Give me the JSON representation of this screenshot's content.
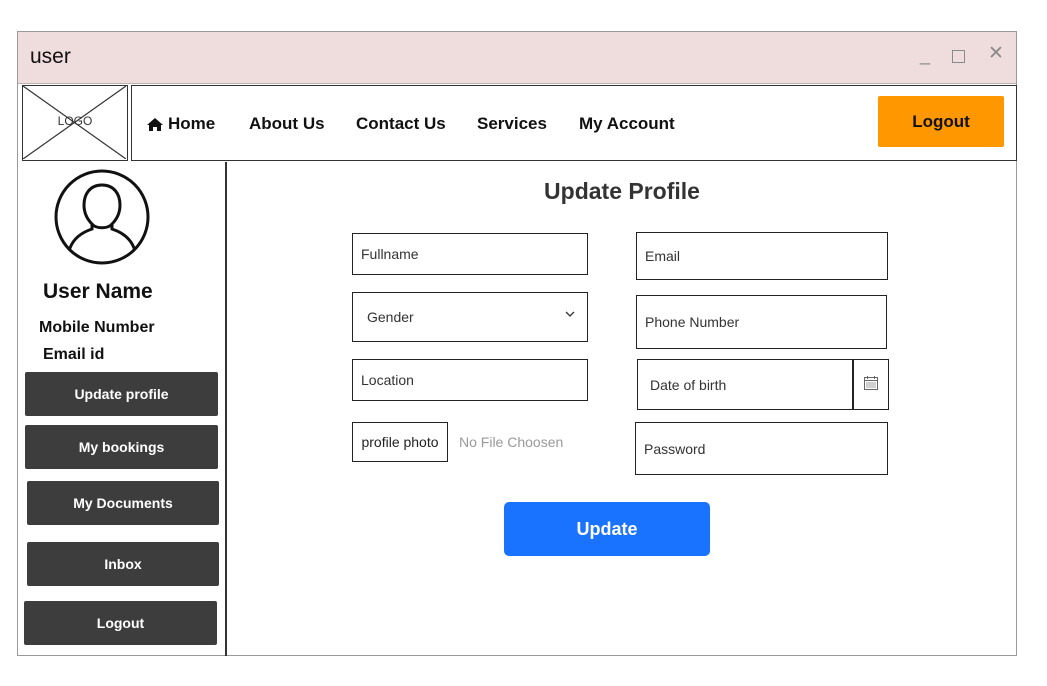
{
  "window": {
    "title": "user"
  },
  "header": {
    "logo_label": "LOGO",
    "nav": [
      "Home",
      "About Us",
      "Contact Us",
      "Services",
      "My Account"
    ],
    "logout_label": "Logout"
  },
  "sidebar": {
    "user_name": "User Name",
    "mobile": "Mobile Number",
    "email": "Email id",
    "buttons": [
      "Update profile",
      "My bookings",
      "My Documents",
      "Inbox",
      "Logout"
    ]
  },
  "form": {
    "title": "Update Profile",
    "fullname_placeholder": "Fullname",
    "email_placeholder": "Email",
    "gender_value": "Gender",
    "phone_placeholder": "Phone Number",
    "location_placeholder": "Location",
    "dob_placeholder": "Date of birth",
    "photo_button": "profile photo",
    "photo_status": "No File Choosen",
    "password_placeholder": "Password",
    "submit_label": "Update"
  },
  "colors": {
    "titlebar": "#efdcdc",
    "logout_accent": "#ff9800",
    "sidebar_button": "#3d3d3d",
    "primary": "#1a73ff"
  },
  "icons": [
    "home-icon",
    "avatar-icon",
    "calendar-icon",
    "chevron-down-icon",
    "minimize-icon",
    "maximize-icon",
    "close-icon"
  ]
}
